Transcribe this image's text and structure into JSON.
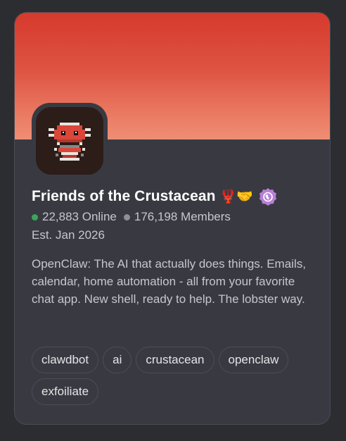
{
  "server": {
    "name": "Friends of the Crustacean",
    "name_emojis": "🦞🤝",
    "online_count": "22,883 Online",
    "member_count": "176,198 Members",
    "established": "Est. Jan 2026",
    "description": "OpenClaw: The AI that actually does things. Emails, calendar, home automation - all from your favorite chat app. New shell, ready to help. The lobster way.",
    "badge_icon": "community-globe-icon",
    "avatar_icon": "pixel-lobster-icon"
  },
  "tags": [
    "clawdbot",
    "ai",
    "crustacean",
    "openclaw",
    "exfoiliate"
  ],
  "colors": {
    "banner_top": "#d63a2c",
    "banner_bottom": "#ef8e75",
    "card_background": "#393a41",
    "online_dot": "#3ba55d",
    "members_dot": "#8d9099",
    "badge": "#b77fd6"
  }
}
